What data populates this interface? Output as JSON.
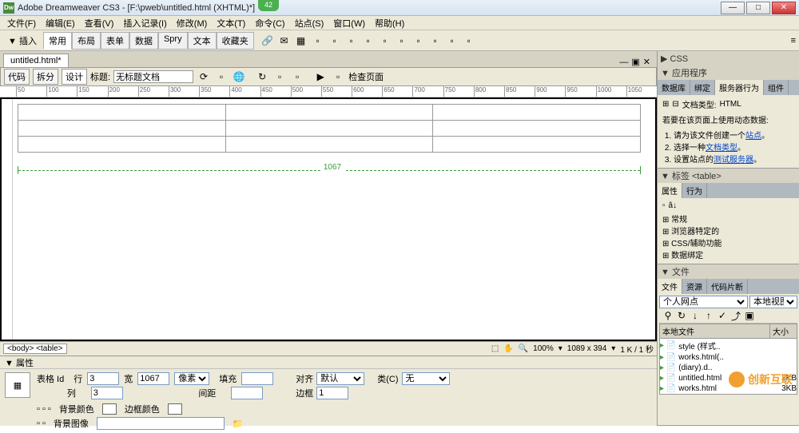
{
  "title": "Adobe Dreamweaver CS3 - [F:\\pweb\\untitled.html (XHTML)*]",
  "badge": "42",
  "menu": [
    "文件(F)",
    "编辑(E)",
    "查看(V)",
    "插入记录(I)",
    "修改(M)",
    "文本(T)",
    "命令(C)",
    "站点(S)",
    "窗口(W)",
    "帮助(H)"
  ],
  "insert": {
    "label": "▼ 插入",
    "tabs": [
      "常用",
      "布局",
      "表单",
      "数据",
      "Spry",
      "文本",
      "收藏夹"
    ]
  },
  "doc": {
    "tab": "untitled.html*",
    "views": {
      "code": "代码",
      "split": "拆分",
      "design": "设计"
    },
    "title_label": "标题:",
    "title_value": "无标题文档",
    "check_page": "检查页面",
    "status_tags": "<body> <table>",
    "zoom": "100%",
    "dims": "1089 x 394",
    "size": "1 K / 1 秒",
    "ruler_marks": [
      "50",
      "100",
      "150",
      "200",
      "250",
      "300",
      "350",
      "400",
      "450",
      "500",
      "550",
      "600",
      "650",
      "700",
      "750",
      "800",
      "850",
      "900",
      "950",
      "1000",
      "1050"
    ],
    "table_width": "1067"
  },
  "props": {
    "head": "▼ 属性",
    "id_label": "表格 Id",
    "rows_l": "行",
    "rows_v": "3",
    "cols_l": "列",
    "cols_v": "3",
    "width_l": "宽",
    "width_v": "1067",
    "width_unit": "像素",
    "pad_l": "填充",
    "pad_v": "",
    "space_l": "间距",
    "space_v": "",
    "align_l": "对齐",
    "align_v": "默认",
    "border_l": "边框",
    "border_v": "1",
    "class_l": "类(C)",
    "class_v": "无",
    "bgcolor_l": "背景颜色",
    "bdcolor_l": "边框颜色",
    "bgimg_l": "背景图像"
  },
  "side": {
    "css_head": "▶ CSS",
    "app_head": "▼ 应用程序",
    "app_tabs": [
      "数据库",
      "绑定",
      "服务器行为",
      "组件"
    ],
    "doctype_l": "文档类型:",
    "doctype_v": "HTML",
    "app_msg": "若要在该页面上使用动态数据:",
    "app_steps": [
      {
        "t1": "请为该文件创建一个",
        "a": "站点",
        "t2": "。"
      },
      {
        "t1": "选择一种",
        "a": "文档类型",
        "t2": "。"
      },
      {
        "t1": "设置站点的",
        "a": "测试服务器",
        "t2": "。"
      }
    ],
    "tag_head": "▼ 标签 <table>",
    "tag_tabs": [
      "属性",
      "行为"
    ],
    "tag_items": [
      "常规",
      "浏览器特定的",
      "CSS/辅助功能",
      "数据绑定"
    ],
    "files_head": "▼ 文件",
    "files_tabs": [
      "文件",
      "资源",
      "代码片断"
    ],
    "site_name": "个人网点",
    "view": "本地视图",
    "cols": {
      "name": "本地文件",
      "size": "大小"
    },
    "files": [
      {
        "n": "style (样式..",
        "s": ""
      },
      {
        "n": "works.html(..",
        "s": ""
      },
      {
        "n": "(diary).d..",
        "s": ""
      },
      {
        "n": "untitled.html",
        "s": "2KB"
      },
      {
        "n": "works.html",
        "s": "3KB"
      }
    ]
  },
  "watermark": "创新互联"
}
